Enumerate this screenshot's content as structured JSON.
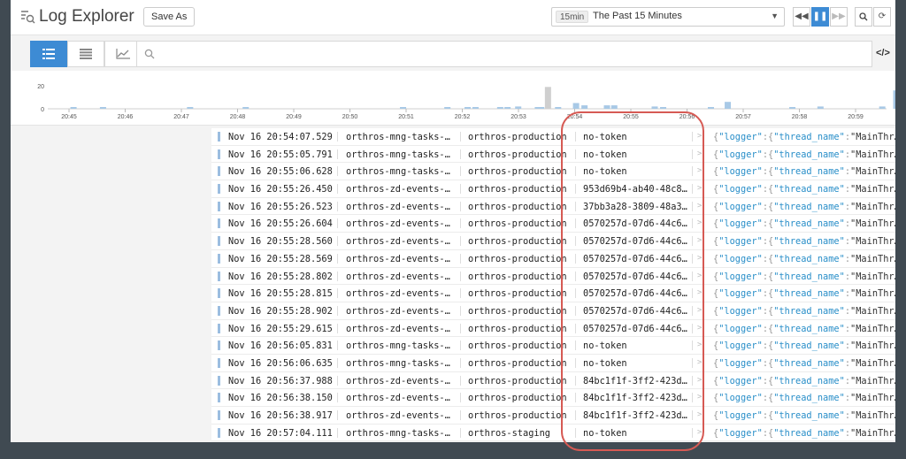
{
  "header": {
    "title": "Log Explorer",
    "save_as_label": "Save As",
    "time_range": {
      "badge": "15min",
      "label": "The Past 15 Minutes"
    }
  },
  "search": {
    "placeholder": "",
    "value": ""
  },
  "code_toggle": "</>",
  "histogram": {
    "y_ticks": [
      "20",
      "0"
    ],
    "x_ticks": [
      "20:45",
      "20:46",
      "20:47",
      "20:48",
      "20:49",
      "20:50",
      "20:51",
      "20:52",
      "20:53",
      "20:54",
      "20:55",
      "20:56",
      "20:57",
      "20:58",
      "20:59"
    ],
    "bars": [
      {
        "t": 20.755,
        "v": 1,
        "c": "#a8c9e6"
      },
      {
        "t": 21.28,
        "v": 1,
        "c": "#a8c9e6"
      },
      {
        "t": 22.83,
        "v": 1,
        "c": "#a8c9e6"
      },
      {
        "t": 23.82,
        "v": 1,
        "c": "#a8c9e6"
      },
      {
        "t": 26.62,
        "v": 1,
        "c": "#a8c9e6"
      },
      {
        "t": 27.41,
        "v": 1,
        "c": "#a8c9e6"
      },
      {
        "t": 27.77,
        "v": 1,
        "c": "#a8c9e6"
      },
      {
        "t": 27.91,
        "v": 1,
        "c": "#a8c9e6"
      },
      {
        "t": 28.35,
        "v": 1,
        "c": "#a8c9e6"
      },
      {
        "t": 28.48,
        "v": 1,
        "c": "#a8c9e6"
      },
      {
        "t": 28.67,
        "v": 2,
        "c": "#a8c9e6"
      },
      {
        "t": 29.02,
        "v": 1,
        "c": "#a8c9e6"
      },
      {
        "t": 29.08,
        "v": 1,
        "c": "#a8c9e6"
      },
      {
        "t": 29.2,
        "v": 19,
        "c": "#cfcfcf"
      },
      {
        "t": 29.38,
        "v": 1,
        "c": "#a8c9e6"
      },
      {
        "t": 29.7,
        "v": 5,
        "c": "#a8c9e6"
      },
      {
        "t": 29.85,
        "v": 3,
        "c": "#a8c9e6"
      },
      {
        "t": 30.25,
        "v": 3,
        "c": "#a8c9e6"
      },
      {
        "t": 30.38,
        "v": 3,
        "c": "#a8c9e6"
      },
      {
        "t": 31.1,
        "v": 2,
        "c": "#a8c9e6"
      },
      {
        "t": 31.25,
        "v": 1,
        "c": "#a8c9e6"
      },
      {
        "t": 32.1,
        "v": 1,
        "c": "#a8c9e6"
      },
      {
        "t": 32.4,
        "v": 6,
        "c": "#a8c9e6"
      },
      {
        "t": 33.55,
        "v": 1,
        "c": "#a8c9e6"
      },
      {
        "t": 34.05,
        "v": 2,
        "c": "#a8c9e6"
      },
      {
        "t": 35.15,
        "v": 2,
        "c": "#a8c9e6"
      },
      {
        "t": 35.4,
        "v": 16,
        "c": "#a8c9e6"
      },
      {
        "t": 35.77,
        "v": 6,
        "c": "#a8c9e6"
      },
      {
        "t": 36.05,
        "v": 16,
        "c": "#a8c9e6"
      },
      {
        "t": 36.15,
        "v": 5,
        "c": "#a8c9e6"
      },
      {
        "t": 36.4,
        "v": 14,
        "c": "#a8c9e6"
      },
      {
        "t": 36.55,
        "v": 4,
        "c": "#a8c9e6"
      }
    ]
  },
  "logs": [
    {
      "date": "Nov 16 20:54:07.529",
      "host": "orthros-mng-tasks-…",
      "service": "orthros-production",
      "trace": "no-token"
    },
    {
      "date": "Nov 16 20:55:05.791",
      "host": "orthros-mng-tasks-…",
      "service": "orthros-production",
      "trace": "no-token"
    },
    {
      "date": "Nov 16 20:55:06.628",
      "host": "orthros-mng-tasks-…",
      "service": "orthros-production",
      "trace": "no-token"
    },
    {
      "date": "Nov 16 20:55:26.450",
      "host": "orthros-zd-events-…",
      "service": "orthros-production",
      "trace": "953d69b4-ab40-48c8…"
    },
    {
      "date": "Nov 16 20:55:26.523",
      "host": "orthros-zd-events-…",
      "service": "orthros-production",
      "trace": "37bb3a28-3809-48a3…"
    },
    {
      "date": "Nov 16 20:55:26.604",
      "host": "orthros-zd-events-…",
      "service": "orthros-production",
      "trace": "0570257d-07d6-44c6…"
    },
    {
      "date": "Nov 16 20:55:28.560",
      "host": "orthros-zd-events-…",
      "service": "orthros-production",
      "trace": "0570257d-07d6-44c6…"
    },
    {
      "date": "Nov 16 20:55:28.569",
      "host": "orthros-zd-events-…",
      "service": "orthros-production",
      "trace": "0570257d-07d6-44c6…"
    },
    {
      "date": "Nov 16 20:55:28.802",
      "host": "orthros-zd-events-…",
      "service": "orthros-production",
      "trace": "0570257d-07d6-44c6…"
    },
    {
      "date": "Nov 16 20:55:28.815",
      "host": "orthros-zd-events-…",
      "service": "orthros-production",
      "trace": "0570257d-07d6-44c6…"
    },
    {
      "date": "Nov 16 20:55:28.902",
      "host": "orthros-zd-events-…",
      "service": "orthros-production",
      "trace": "0570257d-07d6-44c6…"
    },
    {
      "date": "Nov 16 20:55:29.615",
      "host": "orthros-zd-events-…",
      "service": "orthros-production",
      "trace": "0570257d-07d6-44c6…"
    },
    {
      "date": "Nov 16 20:56:05.831",
      "host": "orthros-mng-tasks-…",
      "service": "orthros-production",
      "trace": "no-token"
    },
    {
      "date": "Nov 16 20:56:06.635",
      "host": "orthros-mng-tasks-…",
      "service": "orthros-production",
      "trace": "no-token"
    },
    {
      "date": "Nov 16 20:56:37.988",
      "host": "orthros-zd-events-…",
      "service": "orthros-production",
      "trace": "84bc1f1f-3ff2-423d…"
    },
    {
      "date": "Nov 16 20:56:38.150",
      "host": "orthros-zd-events-…",
      "service": "orthros-production",
      "trace": "84bc1f1f-3ff2-423d…"
    },
    {
      "date": "Nov 16 20:56:38.917",
      "host": "orthros-zd-events-…",
      "service": "orthros-production",
      "trace": "84bc1f1f-3ff2-423d…"
    },
    {
      "date": "Nov 16 20:57:04.111",
      "host": "orthros-mng-tasks-…",
      "service": "orthros-staging",
      "trace": "no-token"
    }
  ],
  "message_preview": {
    "logger_key": "logger",
    "thread_key": "thread_name",
    "thread_value": "MainThr…",
    "expand_glyph": ">"
  },
  "colors": {
    "accent": "#3d8bd4",
    "status_bar": "#9bbde0",
    "json_key": "#2a8fc9",
    "highlight": "#d65a54"
  }
}
